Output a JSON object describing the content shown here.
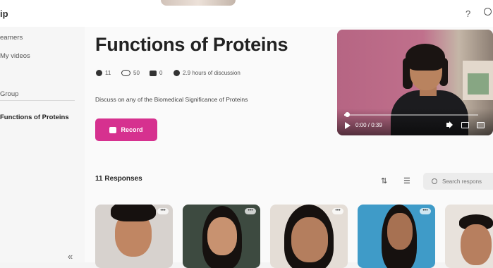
{
  "app": {
    "brand": "ip"
  },
  "topbar": {
    "help": "?"
  },
  "sidebar": {
    "items": [
      {
        "label": "earners"
      },
      {
        "label": "My videos"
      },
      {
        "label": "Group"
      },
      {
        "label": "Functions of Proteins"
      }
    ],
    "collapse": "«"
  },
  "topic": {
    "title": "Functions of Proteins",
    "stats": [
      {
        "icon": "video-icon",
        "value": "11"
      },
      {
        "icon": "eye-icon",
        "value": "50"
      },
      {
        "icon": "comment-icon",
        "value": "0"
      },
      {
        "icon": "clock-icon",
        "value": "2.9 hours of discussion"
      }
    ],
    "description": "Discuss on any of the Biomedical Significance of Proteins",
    "record_label": "Record"
  },
  "player": {
    "time": "0:00 / 0:39",
    "progress": 0.02
  },
  "responses": {
    "heading": "11 Responses",
    "search_placeholder": "Search respons",
    "sort_icon": "⇅",
    "list_icon": "☰",
    "more": "•••"
  },
  "colors": {
    "accent": "#d6318f"
  }
}
